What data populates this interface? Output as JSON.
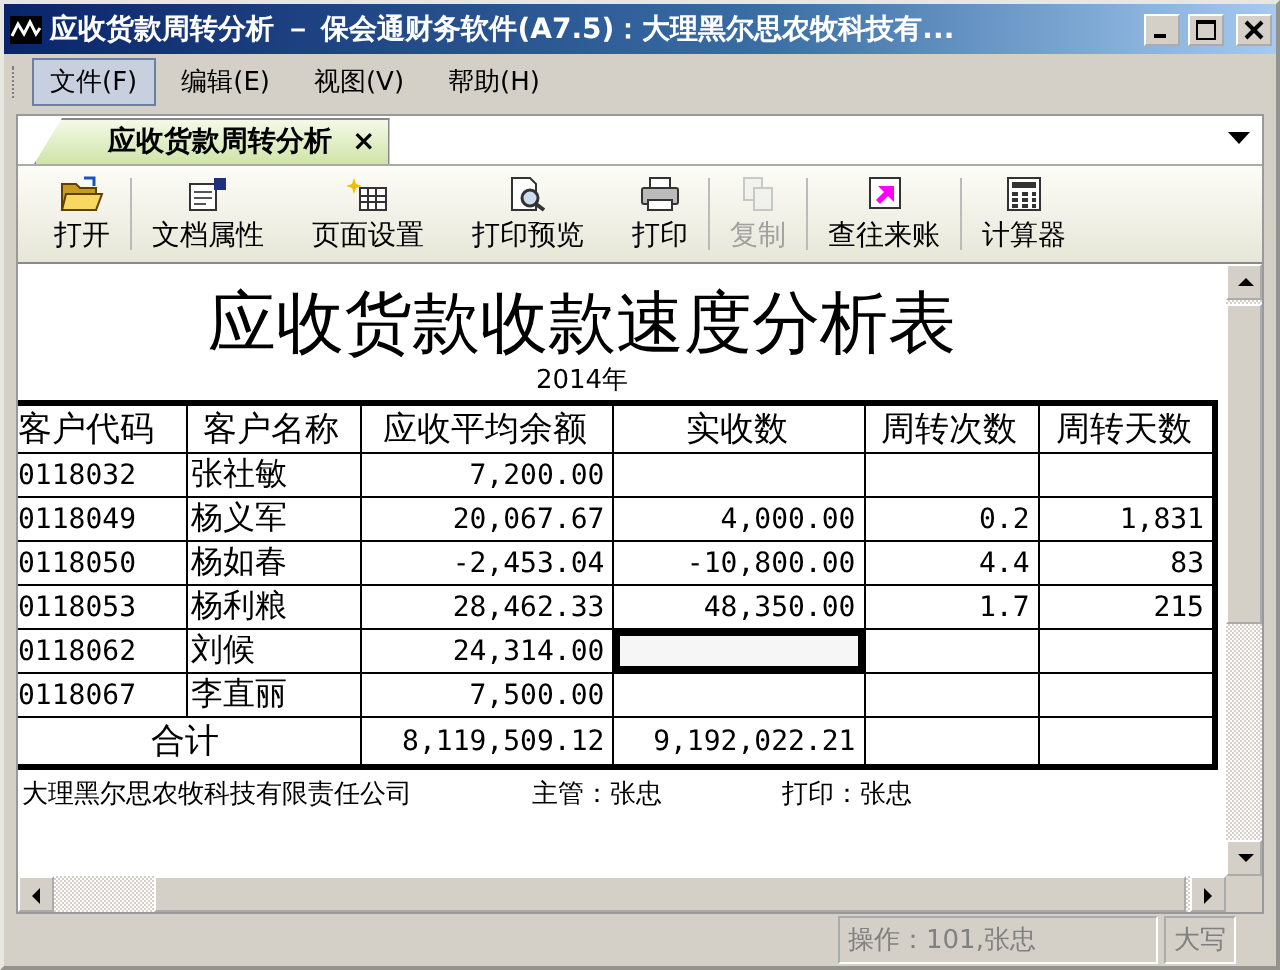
{
  "window": {
    "title": "应收货款周转分析 － 保会通财务软件(A7.5)：大理黑尔思农牧科技有..."
  },
  "menu": [
    {
      "label": "文件(F)",
      "selected": true
    },
    {
      "label": "编辑(E)",
      "selected": false
    },
    {
      "label": "视图(V)",
      "selected": false
    },
    {
      "label": "帮助(H)",
      "selected": false
    }
  ],
  "tabs": [
    {
      "label": "应收货款周转分析",
      "close": "×",
      "selected": true
    }
  ],
  "toolbar": [
    {
      "label": "打开",
      "kind": "folder",
      "disabled": false,
      "separator_after": true
    },
    {
      "label": "文档属性",
      "kind": "properties",
      "disabled": false,
      "separator_after": false
    },
    {
      "label": "页面设置",
      "kind": "page_setup",
      "disabled": false,
      "separator_after": false
    },
    {
      "label": "打印预览",
      "kind": "preview",
      "disabled": false,
      "separator_after": false
    },
    {
      "label": "打印",
      "kind": "printer",
      "disabled": false,
      "separator_after": true
    },
    {
      "label": "复制",
      "kind": "copy",
      "disabled": true,
      "separator_after": true
    },
    {
      "label": "查往来账",
      "kind": "lookup",
      "disabled": false,
      "separator_after": true
    },
    {
      "label": "计算器",
      "kind": "calculator",
      "disabled": false,
      "separator_after": false
    }
  ],
  "report": {
    "title": "应收货款收款速度分析表",
    "year": "2014年",
    "columns": [
      "客户代码",
      "客户名称",
      "应收平均余额",
      "实收数",
      "周转次数",
      "周转天数"
    ],
    "rows": [
      {
        "cells": [
          {
            "text": "0118032",
            "selected": false
          },
          {
            "text": "张社敏",
            "selected": false
          },
          {
            "text": "7,200.00",
            "selected": false
          },
          {
            "selected": false
          },
          {
            "selected": false
          },
          {
            "selected": false
          }
        ]
      },
      {
        "cells": [
          {
            "text": "0118049",
            "selected": false
          },
          {
            "text": "杨义军",
            "selected": false
          },
          {
            "text": "20,067.67",
            "selected": false
          },
          {
            "text": "4,000.00",
            "selected": false
          },
          {
            "text": "0.2",
            "selected": false
          },
          {
            "text": "1,831",
            "selected": false
          }
        ]
      },
      {
        "cells": [
          {
            "text": "0118050",
            "selected": false
          },
          {
            "text": "杨如春",
            "selected": false
          },
          {
            "text": "-2,453.04",
            "selected": false
          },
          {
            "text": "-10,800.00",
            "selected": false
          },
          {
            "text": "4.4",
            "selected": false
          },
          {
            "text": "83",
            "selected": false
          }
        ]
      },
      {
        "cells": [
          {
            "text": "0118053",
            "selected": false
          },
          {
            "text": "杨利粮",
            "selected": false
          },
          {
            "text": "28,462.33",
            "selected": false
          },
          {
            "text": "48,350.00",
            "selected": false
          },
          {
            "text": "1.7",
            "selected": false
          },
          {
            "text": "215",
            "selected": false
          }
        ]
      },
      {
        "cells": [
          {
            "text": "0118062",
            "selected": false
          },
          {
            "text": "刘候",
            "selected": false
          },
          {
            "text": "24,314.00",
            "selected": false
          },
          {
            "selected": true
          },
          {
            "selected": false
          },
          {
            "selected": false
          }
        ]
      },
      {
        "cells": [
          {
            "text": "0118067",
            "selected": false
          },
          {
            "text": "李直丽",
            "selected": false
          },
          {
            "text": "7,500.00",
            "selected": false
          },
          {
            "selected": false
          },
          {
            "selected": false
          },
          {
            "selected": false
          }
        ]
      }
    ],
    "total": {
      "label": "合计",
      "values": [
        "8,119,509.12",
        "9,192,022.21"
      ]
    },
    "footer": {
      "company": "大理黑尔思农牧科技有限责任公司",
      "supervisor": "主管：张忠",
      "printer": "打印：张忠"
    }
  },
  "status_bar": {
    "operator": "操作：101,张忠",
    "caps": "大写"
  }
}
